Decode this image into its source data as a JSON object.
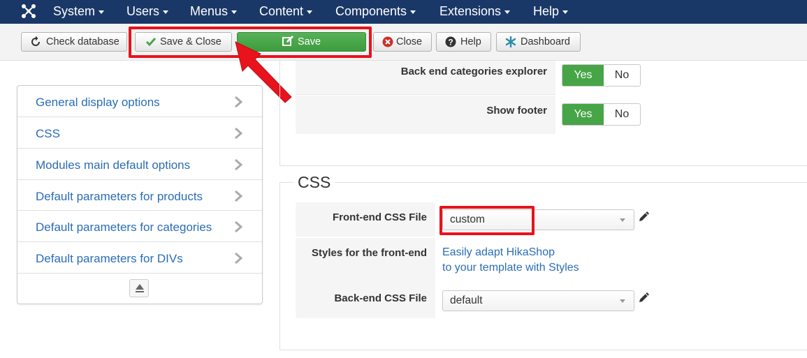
{
  "navbar": {
    "logo": "joomla-icon",
    "items": [
      "System",
      "Users",
      "Menus",
      "Content",
      "Components",
      "Extensions",
      "Help"
    ]
  },
  "toolbar": {
    "check_database": "Check database",
    "save_close": "Save & Close",
    "save": "Save",
    "close": "Close",
    "help": "Help",
    "dashboard": "Dashboard"
  },
  "sidebar": {
    "items": [
      "General display options",
      "CSS",
      "Modules main default options",
      "Default parameters for products",
      "Default parameters for categories",
      "Default parameters for DIVs"
    ]
  },
  "options": {
    "back_end_explorer": {
      "label": "Back end categories explorer",
      "yes": "Yes",
      "no": "No",
      "value": "Yes"
    },
    "show_footer": {
      "label": "Show footer",
      "yes": "Yes",
      "no": "No",
      "value": "Yes"
    }
  },
  "css_section": {
    "legend": "CSS",
    "front_css": {
      "label": "Front-end CSS File",
      "value": "custom"
    },
    "styles": {
      "label": "Styles for the front-end",
      "link_line1": "Easily adapt HikaShop",
      "link_line2": "to your template with Styles"
    },
    "back_css": {
      "label": "Back-end CSS File",
      "value": "default"
    }
  },
  "colors": {
    "navbar_bg": "#1a3867",
    "save_green": "#46a546",
    "link_blue": "#2a6db5",
    "highlight_red": "#e8131c"
  }
}
